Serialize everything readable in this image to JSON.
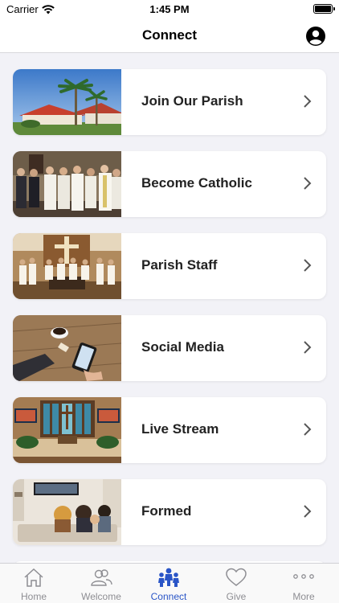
{
  "status_bar": {
    "carrier": "Carrier",
    "time": "1:45 PM"
  },
  "header": {
    "title": "Connect"
  },
  "items": [
    {
      "label": "Join Our Parish",
      "icon": "church-exterior-photo"
    },
    {
      "label": "Become Catholic",
      "icon": "clergy-group-photo"
    },
    {
      "label": "Parish Staff",
      "icon": "altar-photo"
    },
    {
      "label": "Social Media",
      "icon": "phone-coffee-photo"
    },
    {
      "label": "Live Stream",
      "icon": "sanctuary-photo"
    },
    {
      "label": "Formed",
      "icon": "family-tv-photo"
    }
  ],
  "tabs": [
    {
      "label": "Home",
      "icon": "home-icon",
      "active": false
    },
    {
      "label": "Welcome",
      "icon": "people-icon",
      "active": false
    },
    {
      "label": "Connect",
      "icon": "group-icon",
      "active": true
    },
    {
      "label": "Give",
      "icon": "heart-icon",
      "active": false
    },
    {
      "label": "More",
      "icon": "ellipsis-icon",
      "active": false
    }
  ],
  "colors": {
    "accent": "#2a55c7",
    "inactive": "#8e8e93",
    "background": "#f2f2f7"
  }
}
